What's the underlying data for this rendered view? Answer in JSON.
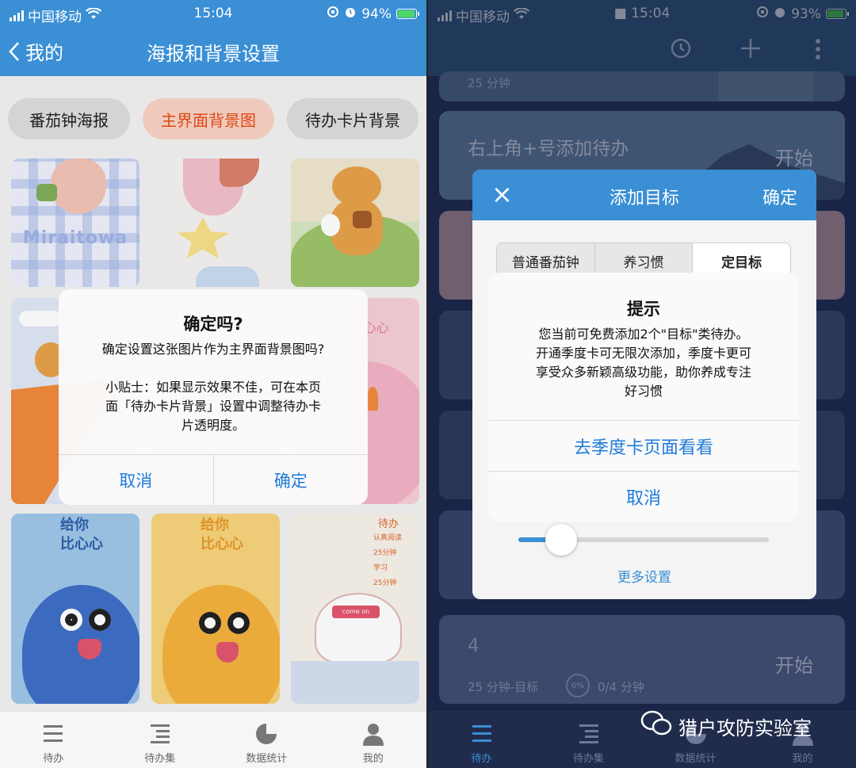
{
  "left": {
    "status": {
      "carrier": "中国移动",
      "time": "15:04",
      "battery": "94%"
    },
    "nav": {
      "back_label": "我的",
      "title": "海报和背景设置"
    },
    "tabs": [
      {
        "label": "番茄钟海报",
        "active": false
      },
      {
        "label": "主界面背景图",
        "active": true
      },
      {
        "label": "待办卡片背景",
        "active": false
      }
    ],
    "tiles": {
      "miraitowa": "Miraitowa",
      "pink_text": "给你 比心心",
      "blue_text_1": "给你",
      "blue_text_2": "比心心",
      "yellow_text_1": "给你",
      "yellow_text_2": "比心心",
      "bunny_tag": "come on",
      "todo_head": "待办",
      "todo_lines": [
        "认真阅读",
        "25分钟",
        "学习",
        "25分钟"
      ]
    },
    "alert": {
      "title": "确定吗?",
      "line1": "确定设置这张图片作为主界面背景图吗?",
      "line2": "小贴士：如果显示效果不佳，可在本页",
      "line3": "面「待办卡片背景」设置中调整待办卡",
      "line4": "片透明度。",
      "cancel": "取消",
      "confirm": "确定"
    },
    "tabbar": [
      "待办",
      "待办集",
      "数据统计",
      "我的"
    ]
  },
  "right": {
    "status": {
      "carrier": "中国移动",
      "time": "15:04",
      "battery": "93%"
    },
    "cards": {
      "top_sub": "25 分钟",
      "card2_title": "右上角+号添加待办",
      "card2_start": "开始",
      "card4_title": "4",
      "card4_sub": "25 分钟-目标",
      "card4_pct": "0%",
      "card4_progress": "0/4 分钟",
      "card4_start": "开始"
    },
    "sheet": {
      "close": "×",
      "title": "添加目标",
      "confirm": "确定",
      "segments": [
        {
          "label": "普通番茄钟",
          "active": false
        },
        {
          "label": "养习惯",
          "active": false
        },
        {
          "label": "定目标",
          "active": true
        }
      ],
      "more": "更多设置",
      "slider_level": 0.17
    },
    "alert": {
      "title": "提示",
      "line1": "您当前可免费添加2个\"目标\"类待办。",
      "line2": "开通季度卡可无限次添加，季度卡更可",
      "line3": "享受众多新颖高级功能，助你养成专注",
      "line4": "好习惯",
      "primary": "去季度卡页面看看",
      "cancel": "取消"
    },
    "tabbar": [
      "待办",
      "待办集",
      "数据统计",
      "我的"
    ],
    "watermark": "猎户攻防实验室"
  },
  "colors": {
    "brand_blue": "#3a8fd5",
    "accent_orange": "#e84a16",
    "ios_blue": "#1f7bd9"
  }
}
